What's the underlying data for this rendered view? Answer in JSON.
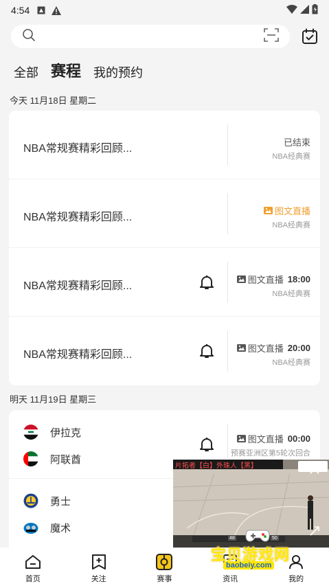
{
  "status_bar": {
    "time": "4:54"
  },
  "search": {
    "placeholder": ""
  },
  "tabs": [
    {
      "label": "全部"
    },
    {
      "label": "赛程"
    },
    {
      "label": "我的预约"
    }
  ],
  "today": {
    "date_label": "今天 11月18日 星期二",
    "rows": [
      {
        "title": "NBA常规赛精彩回顾...",
        "status": "已结束",
        "league": "NBA经典赛"
      },
      {
        "title": "NBA常规赛精彩回顾...",
        "status": "图文直播",
        "league": "NBA经典赛"
      },
      {
        "title": "NBA常规赛精彩回顾...",
        "status": "图文直播",
        "time": "18:00",
        "league": "NBA经典赛"
      },
      {
        "title": "NBA常规赛精彩回顾...",
        "status": "图文直播",
        "time": "20:00",
        "league": "NBA经典赛"
      }
    ]
  },
  "tomorrow": {
    "date_label": "明天 11月19日 星期三",
    "matches": [
      {
        "team1": "伊拉克",
        "team2": "阿联酋",
        "status": "图文直播",
        "time": "00:00",
        "league": "预赛亚洲区第5轮次回合"
      },
      {
        "team1": "勇士",
        "team2": "魔术"
      }
    ]
  },
  "video_overlay": {
    "caption": "片拓者【白】外珠人【黑】",
    "score_left": "48",
    "score_right": "50"
  },
  "bottom_nav": [
    {
      "label": "首页"
    },
    {
      "label": "关注"
    },
    {
      "label": "赛事"
    },
    {
      "label": "资讯"
    },
    {
      "label": "我的"
    }
  ],
  "watermark": {
    "text": "宝贝游戏网",
    "url": "baobeiy.com"
  },
  "colors": {
    "accent_yellow": "#f5c518",
    "orange": "#f0a030",
    "background": "#f4f4f4"
  }
}
